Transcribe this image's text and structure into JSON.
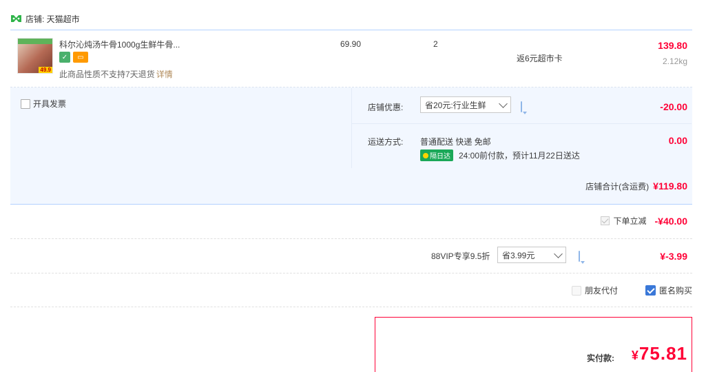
{
  "shop": {
    "label": "店铺: 天猫超市"
  },
  "item": {
    "title": "科尔沁炖汤牛骨1000g生鲜牛骨...",
    "thumb_price_badge": "49.9",
    "unit_price": "69.90",
    "quantity": "2",
    "rebate": "返6元超市卡",
    "subtotal": "139.80",
    "weight": "2.12kg",
    "no_return_text": "此商品性质不支持7天退货",
    "detail_link": "详情"
  },
  "invoice": {
    "label": "开具发票",
    "checked": false
  },
  "shop_discount": {
    "label": "店铺优惠:",
    "selected": "省20元:行业生鲜",
    "value": "-20.00"
  },
  "shipping": {
    "label": "运送方式:",
    "method": "普通配送 快递 免邮",
    "badge": "隔日达",
    "note": "24:00前付款，预计11月22日送达",
    "fee": "0.00"
  },
  "shop_total": {
    "label": "店铺合计(含运费)",
    "value": "¥119.80"
  },
  "instant_discount": {
    "label": "下单立减",
    "value": "-¥40.00"
  },
  "vip": {
    "label": "88VIP专享9.5折",
    "selected": "省3.99元",
    "value": "¥-3.99"
  },
  "options": {
    "friend_pay": "朋友代付",
    "anonymous": "匿名购买"
  },
  "payment": {
    "label": "实付款:",
    "currency": "¥",
    "amount": "75.81"
  },
  "colors": {
    "accent": "#ff0036",
    "blue_bg": "#f2f7ff",
    "blue_border": "#b2d1ff"
  }
}
